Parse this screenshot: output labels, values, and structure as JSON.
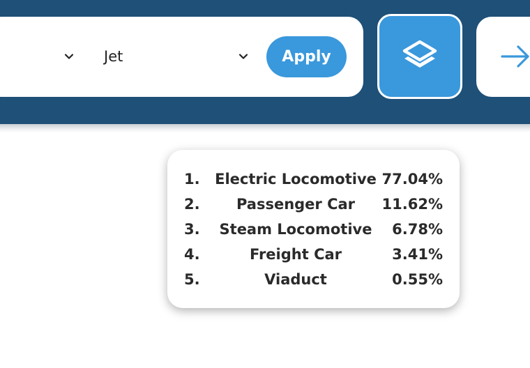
{
  "filters": {
    "select_1": {
      "value": "",
      "icon": "chevron-down-icon"
    },
    "select_2": {
      "value": "Jet",
      "icon": "chevron-down-icon"
    },
    "apply_label": "Apply"
  },
  "toolbar": {
    "layers_icon": "layers-icon",
    "next_icon": "arrow-right-icon"
  },
  "colors": {
    "header_bg": "#1e5078",
    "accent": "#3a98dc",
    "text": "#2a2a2a"
  },
  "results": [
    {
      "rank": "1.",
      "label": "Electric Locomotive",
      "percent": "77.04%"
    },
    {
      "rank": "2.",
      "label": "Passenger Car",
      "percent": "11.62%"
    },
    {
      "rank": "3.",
      "label": "Steam Locomotive",
      "percent": "6.78%"
    },
    {
      "rank": "4.",
      "label": "Freight Car",
      "percent": "3.41%"
    },
    {
      "rank": "5.",
      "label": "Viaduct",
      "percent": "0.55%"
    }
  ]
}
